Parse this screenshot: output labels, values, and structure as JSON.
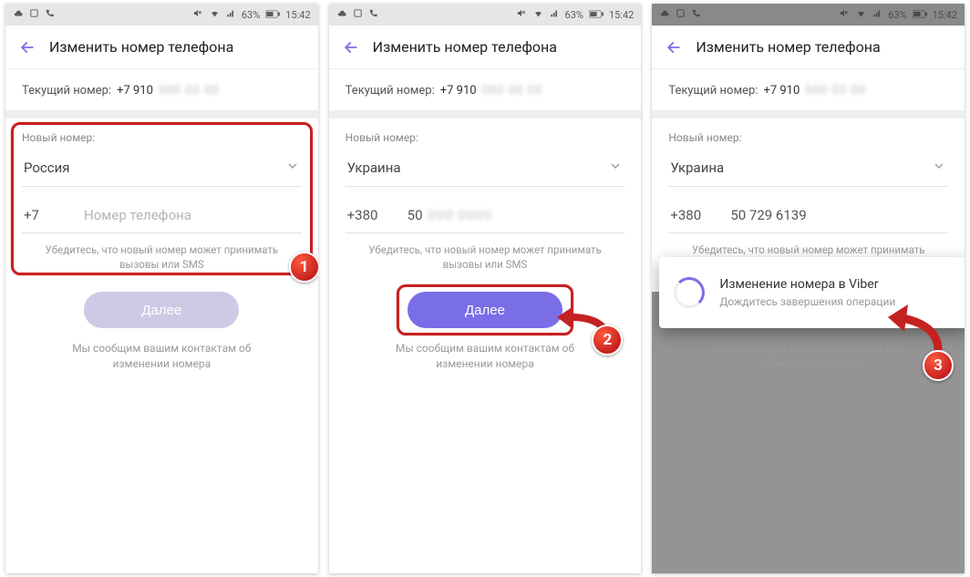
{
  "statusbar": {
    "battery": "63%",
    "time": "15:42"
  },
  "header": {
    "title": "Изменить номер телефона"
  },
  "current": {
    "label": "Текущий номер:",
    "value_visible": "+7 910"
  },
  "form": {
    "label": "Новый номер:",
    "hint_line1": "Убедитесь, что новый номер может принимать",
    "hint_line2": "вызовы или SMS"
  },
  "button": {
    "label": "Далее"
  },
  "notice": {
    "line1": "Мы сообщим вашим контактам об",
    "line2": "изменении номера"
  },
  "screen1": {
    "country": "Россия",
    "code": "+7",
    "phone_placeholder": "Номер телефона"
  },
  "screen2": {
    "country": "Украина",
    "code": "+380",
    "phone_visible": "50"
  },
  "screen3": {
    "country": "Украина",
    "code": "+380",
    "phone": "50 729 6139",
    "dialog_title": "Изменение номера в Viber",
    "dialog_sub": "Дождитесь завершения операции"
  },
  "badges": {
    "s1": "1",
    "s2": "2",
    "s3": "3"
  }
}
